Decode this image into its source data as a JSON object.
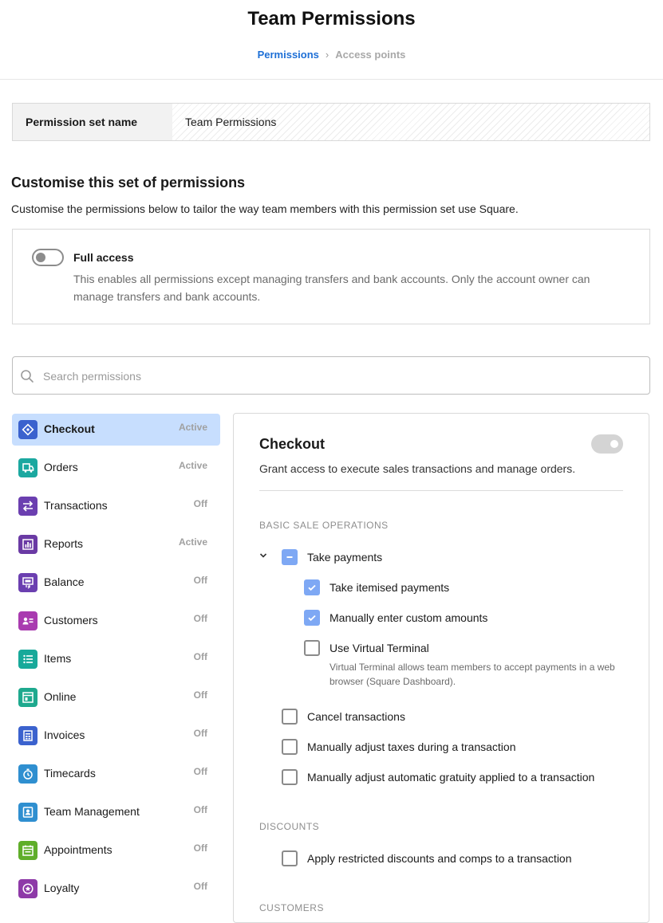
{
  "header": {
    "title": "Team Permissions",
    "breadcrumb": {
      "active": "Permissions",
      "separator": "›",
      "next": "Access points"
    }
  },
  "permission_set": {
    "label": "Permission set name",
    "value": "Team Permissions"
  },
  "customise": {
    "title": "Customise this set of permissions",
    "description": "Customise the permissions below to tailor the way team members with this permission set use Square."
  },
  "full_access": {
    "title": "Full access",
    "description": "This enables all permissions except managing transfers and bank accounts. Only the account owner can manage transfers and bank accounts.",
    "enabled": false
  },
  "search": {
    "placeholder": "Search permissions",
    "value": ""
  },
  "sidebar": {
    "items": [
      {
        "label": "Checkout",
        "status": "Active",
        "icon": "checkout-icon",
        "color": "#3b62ce",
        "selected": true
      },
      {
        "label": "Orders",
        "status": "Active",
        "icon": "orders-icon",
        "color": "#1ba8a0"
      },
      {
        "label": "Transactions",
        "status": "Off",
        "icon": "transactions-icon",
        "color": "#6b3fb0"
      },
      {
        "label": "Reports",
        "status": "Active",
        "icon": "reports-icon",
        "color": "#6a3aa4"
      },
      {
        "label": "Balance",
        "status": "Off",
        "icon": "balance-icon",
        "color": "#6b3fb0"
      },
      {
        "label": "Customers",
        "status": "Off",
        "icon": "customers-icon",
        "color": "#a93bb0"
      },
      {
        "label": "Items",
        "status": "Off",
        "icon": "items-icon",
        "color": "#18a99a"
      },
      {
        "label": "Online",
        "status": "Off",
        "icon": "online-icon",
        "color": "#1ea98e"
      },
      {
        "label": "Invoices",
        "status": "Off",
        "icon": "invoices-icon",
        "color": "#3b62ce"
      },
      {
        "label": "Timecards",
        "status": "Off",
        "icon": "timecards-icon",
        "color": "#2f8fd0"
      },
      {
        "label": "Team Management",
        "status": "Off",
        "icon": "team-management-icon",
        "color": "#2f8fd0"
      },
      {
        "label": "Appointments",
        "status": "Off",
        "icon": "appointments-icon",
        "color": "#5fae2a"
      },
      {
        "label": "Loyalty",
        "status": "Off",
        "icon": "loyalty-icon",
        "color": "#8e3aa8"
      }
    ]
  },
  "panel": {
    "title": "Checkout",
    "description": "Grant access to execute sales transactions and manage orders.",
    "enabled": true,
    "groups": {
      "basic": "BASIC SALE OPERATIONS",
      "discounts": "DISCOUNTS",
      "customers": "CUSTOMERS"
    },
    "permissions": {
      "take_payments": {
        "label": "Take payments",
        "state": "partial"
      },
      "take_itemised": {
        "label": "Take itemised payments",
        "state": "checked"
      },
      "manual_amounts": {
        "label": "Manually enter custom amounts",
        "state": "checked"
      },
      "virtual_terminal": {
        "label": "Use Virtual Terminal",
        "state": "unchecked",
        "note": "Virtual Terminal allows team members to accept payments in a web browser (Square Dashboard)."
      },
      "cancel_transactions": {
        "label": "Cancel transactions",
        "state": "unchecked"
      },
      "adjust_taxes": {
        "label": "Manually adjust taxes during a transaction",
        "state": "unchecked"
      },
      "adjust_gratuity": {
        "label": "Manually adjust automatic gratuity applied to a transaction",
        "state": "unchecked"
      },
      "restricted_discounts": {
        "label": "Apply restricted discounts and comps to a transaction",
        "state": "unchecked"
      }
    }
  }
}
